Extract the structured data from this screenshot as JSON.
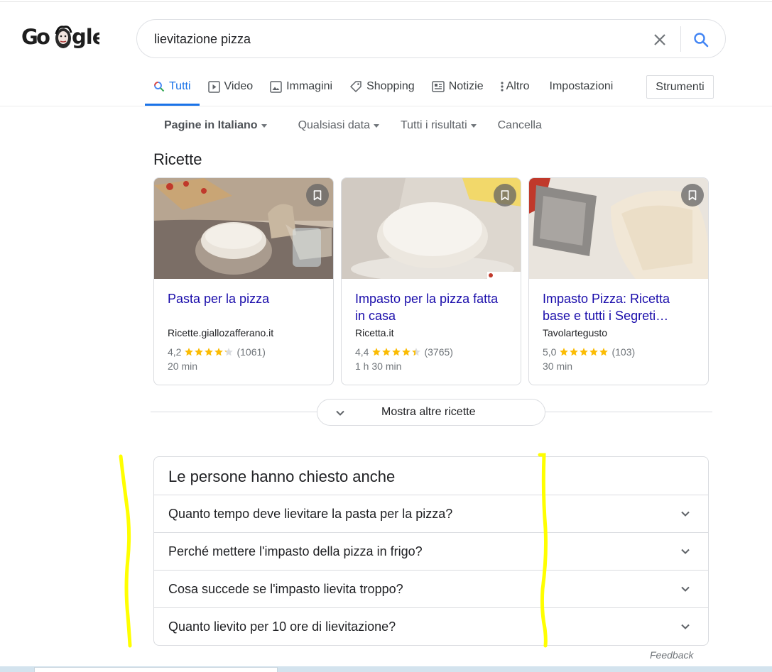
{
  "search": {
    "query": "lievitazione pizza"
  },
  "tabs": [
    {
      "label": "Tutti",
      "icon": "search-icon",
      "active": true
    },
    {
      "label": "Video",
      "icon": "video-icon"
    },
    {
      "label": "Immagini",
      "icon": "image-icon"
    },
    {
      "label": "Shopping",
      "icon": "tag-icon"
    },
    {
      "label": "Notizie",
      "icon": "news-icon"
    },
    {
      "label": "Altro",
      "icon": "more-vert-icon"
    },
    {
      "label": "Impostazioni"
    }
  ],
  "tools_label": "Strumenti",
  "filters": [
    {
      "label": "Pagine in Italiano",
      "dropdown": true
    },
    {
      "label": "Qualsiasi data",
      "dropdown": true
    },
    {
      "label": "Tutti i risultati",
      "dropdown": true
    },
    {
      "label": "Cancella",
      "dropdown": false
    }
  ],
  "recipes": {
    "title": "Ricette",
    "cards": [
      {
        "title": "Pasta per la pizza",
        "source": "Ricette.giallozafferano.it",
        "rating": "4,2",
        "stars": 4.2,
        "reviews": "(1061)",
        "time": "20 min"
      },
      {
        "title": "Impasto per la pizza fatta in casa",
        "source": "Ricetta.it",
        "rating": "4,4",
        "stars": 4.4,
        "reviews": "(3765)",
        "time": "1 h 30 min"
      },
      {
        "title": "Impasto Pizza: Ricetta base e tutti i Segreti…",
        "source": "Tavolartegusto",
        "rating": "5,0",
        "stars": 5.0,
        "reviews": "(103)",
        "time": "30 min"
      }
    ],
    "more_label": "Mostra altre ricette"
  },
  "paa": {
    "title": "Le persone hanno chiesto anche",
    "questions": [
      "Quanto tempo deve lievitare la pasta per la pizza?",
      "Perché mettere l'impasto della pizza in frigo?",
      "Cosa succede se l'impasto lievita troppo?",
      "Quanto lievito per 10 ore di lievitazione?"
    ]
  },
  "feedback_label": "Feedback",
  "colors": {
    "link": "#1a0dab",
    "accent": "#1a73e8",
    "star": "#fbbc04",
    "highlight": "#ffff00"
  }
}
